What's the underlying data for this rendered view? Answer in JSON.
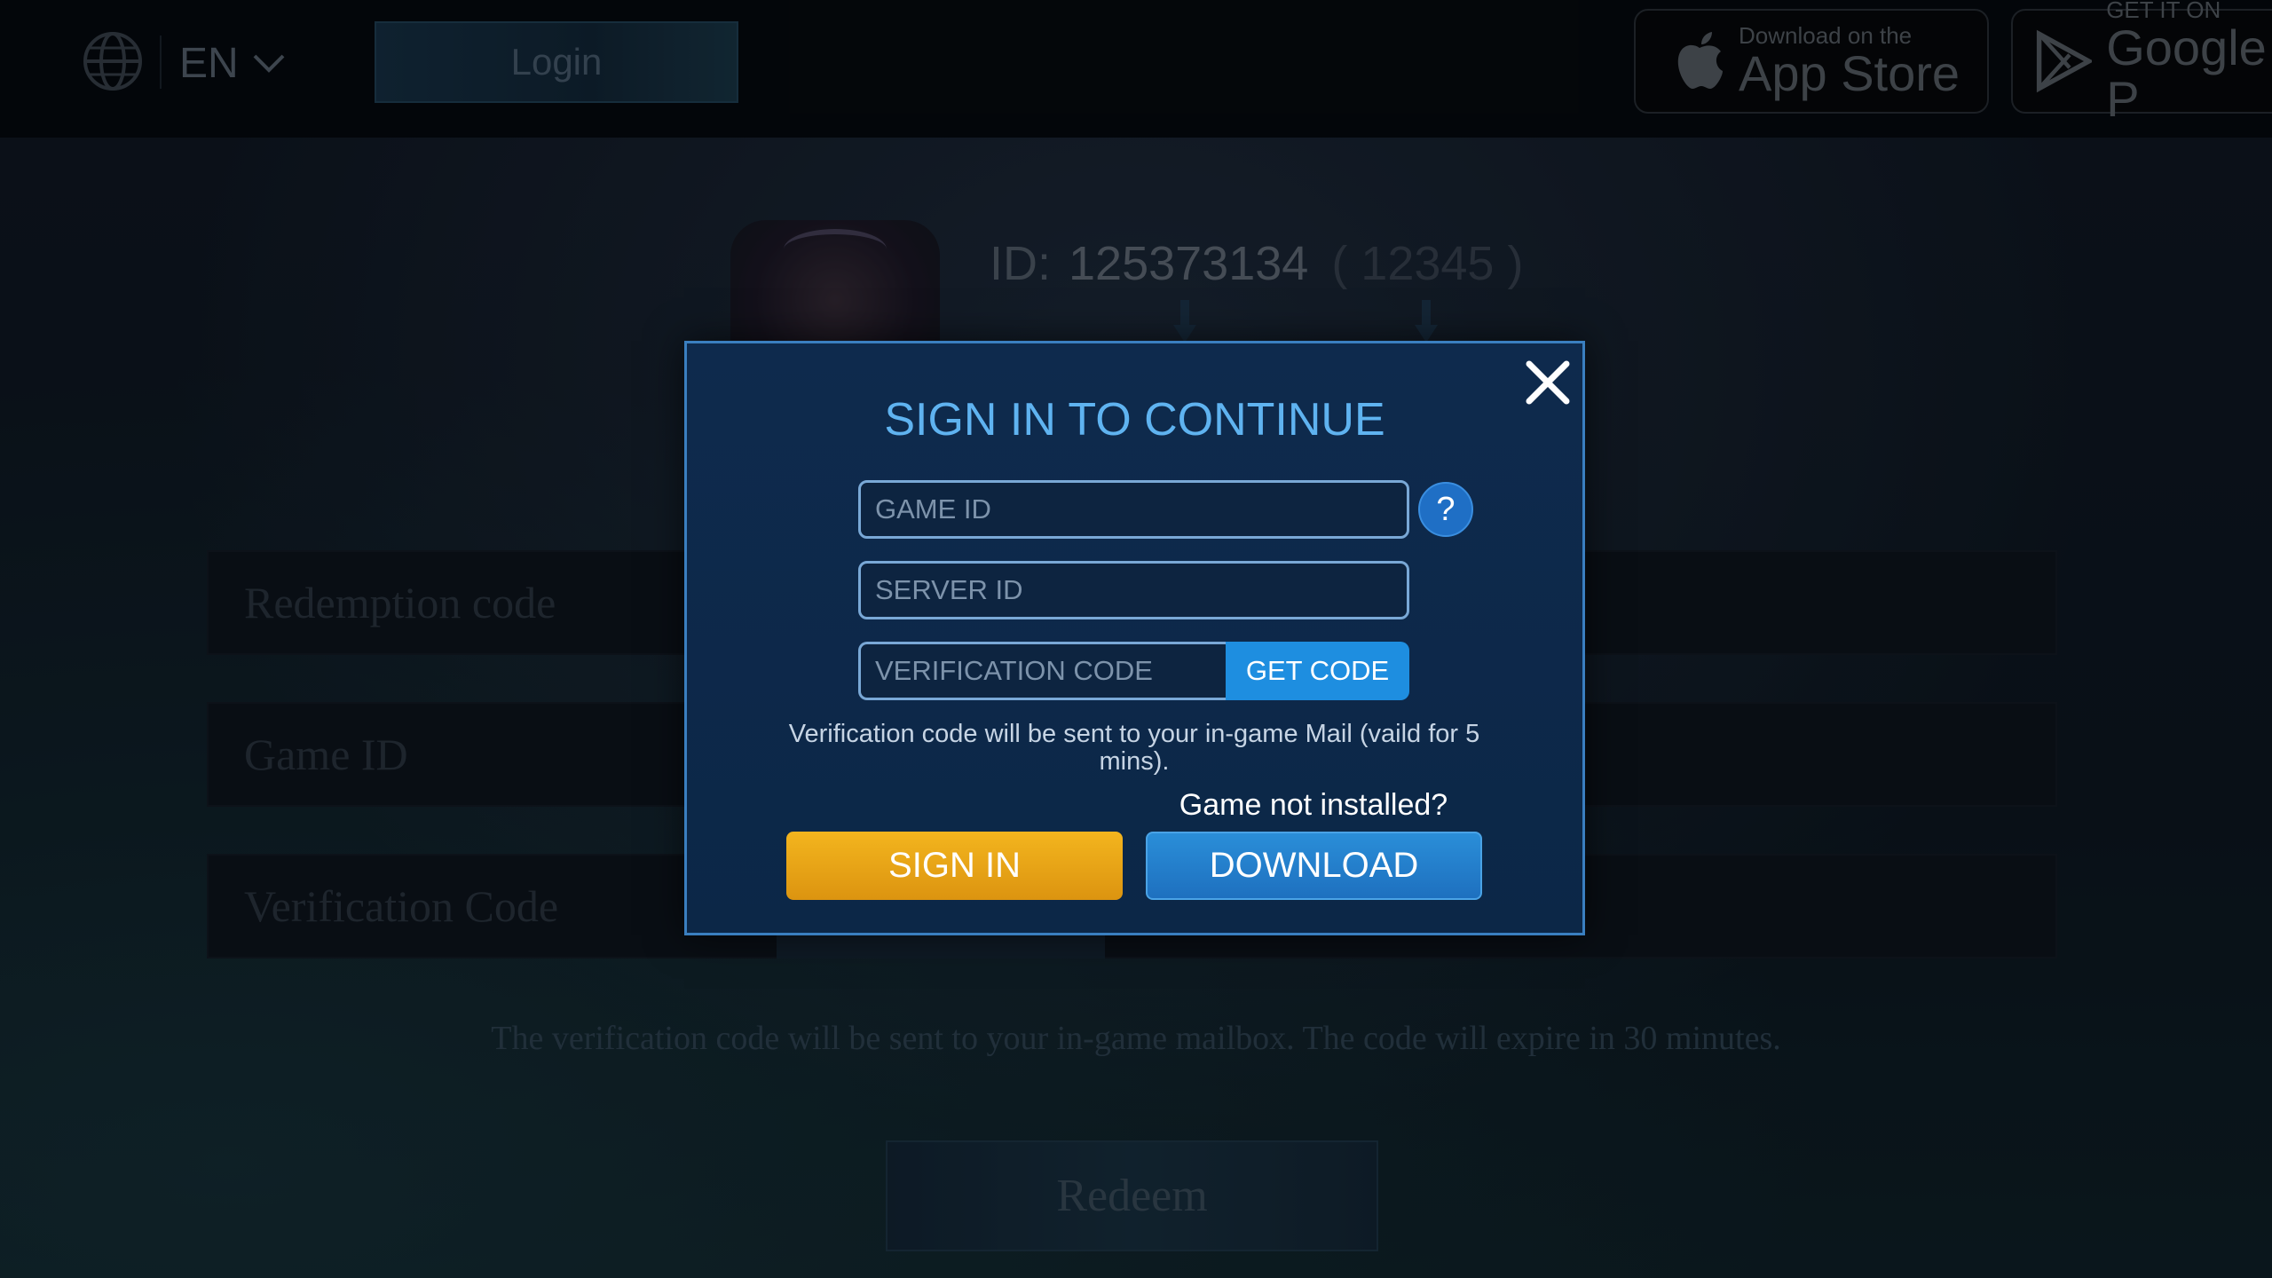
{
  "header": {
    "language": "EN",
    "login_label": "Login",
    "app_store": {
      "small": "Download on the",
      "big": "App Store"
    },
    "google_play": {
      "small": "GET IT ON",
      "big": "Google P"
    }
  },
  "profile": {
    "id_label": "ID:",
    "id_value": "125373134",
    "server_value": "( 12345 )"
  },
  "form": {
    "redemption_placeholder": "Redemption code",
    "game_id_placeholder": "Game ID",
    "verification_placeholder": "Verification Code",
    "note": "The verification code will be sent to your in-game mailbox. The code will expire in 30 minutes.",
    "redeem_label": "Redeem"
  },
  "modal": {
    "title": "SIGN IN TO CONTINUE",
    "game_id_placeholder": "GAME ID",
    "server_id_placeholder": "SERVER ID",
    "verification_placeholder": "VERIFICATION CODE",
    "get_code_label": "GET CODE",
    "help_label": "?",
    "verification_note": "Verification code will be sent to your in-game Mail (vaild for 5 mins).",
    "not_installed": "Game not installed?",
    "sign_in_label": "SIGN IN",
    "download_label": "DOWNLOAD"
  },
  "colors": {
    "accent_blue": "#1e8ee0",
    "sign_in_gold": "#e8a316",
    "title_blue": "#5fb3f0",
    "modal_bg": "#0e2a4d"
  }
}
